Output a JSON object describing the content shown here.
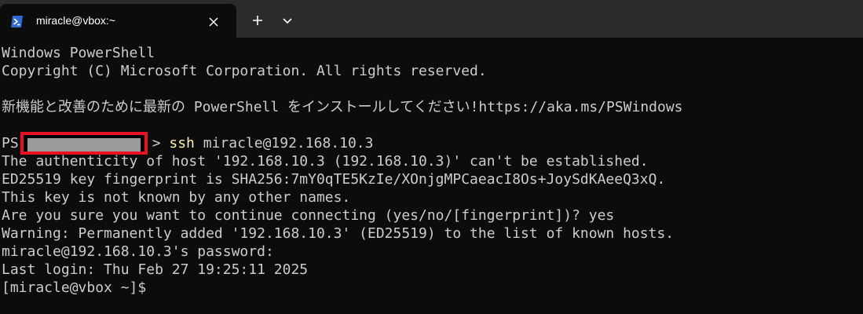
{
  "window": {
    "tab_title": "miracle@vbox:~",
    "tab_icon": "powershell-icon"
  },
  "colors": {
    "background": "#0c0c0c",
    "titlebar": "#2b2b2b",
    "text": "#cccccc",
    "command": "#f9f1a5",
    "redaction_border": "#e81123"
  },
  "terminal": {
    "banner1": "Windows PowerShell",
    "banner2": "Copyright (C) Microsoft Corporation. All rights reserved.",
    "banner3": "新機能と改善のために最新の PowerShell をインストールしてください!https://aka.ms/PSWindows",
    "prompt_prefix": "PS",
    "prompt_suffix": ">",
    "command": "ssh",
    "command_arg": " miracle@192.168.10.3",
    "out1": "The authenticity of host '192.168.10.3 (192.168.10.3)' can't be established.",
    "out2": "ED25519 key fingerprint is SHA256:7mY0qTE5KzIe/XOnjgMPCaeacI8Os+JoySdKAeeQ3xQ.",
    "out3": "This key is not known by any other names.",
    "out4": "Are you sure you want to continue connecting (yes/no/[fingerprint])? yes",
    "out5": "Warning: Permanently added '192.168.10.3' (ED25519) to the list of known hosts.",
    "out6": "miracle@192.168.10.3's password:",
    "out7": "Last login: Thu Feb 27 19:25:11 2025",
    "out8": "[miracle@vbox ~]$"
  }
}
